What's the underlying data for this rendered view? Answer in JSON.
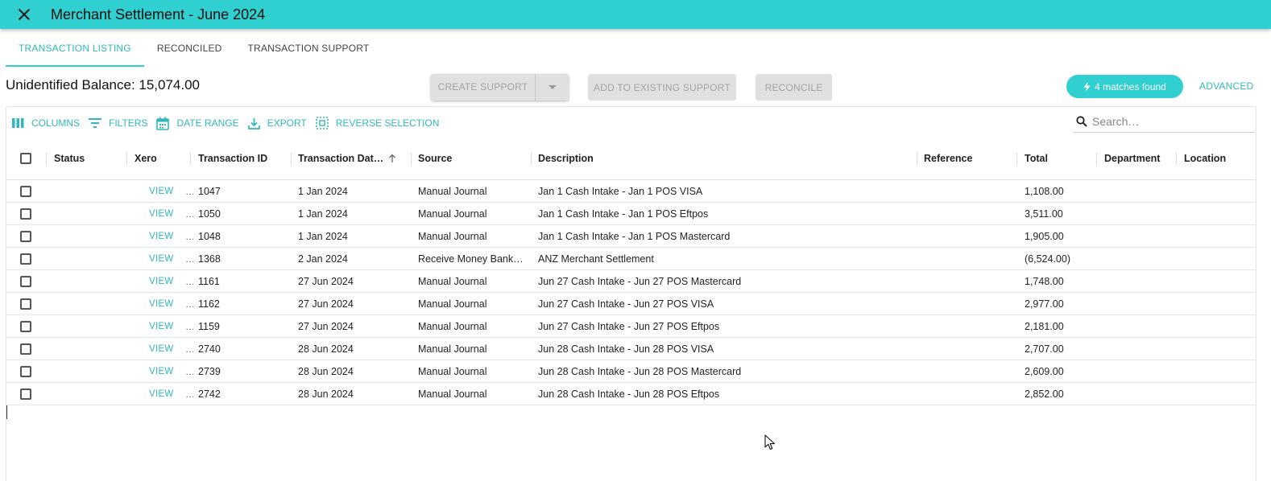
{
  "header": {
    "title": "Merchant Settlement - June 2024"
  },
  "tabs": [
    {
      "label": "TRANSACTION LISTING",
      "active": true
    },
    {
      "label": "RECONCILED",
      "active": false
    },
    {
      "label": "TRANSACTION SUPPORT",
      "active": false
    }
  ],
  "balance": {
    "text": "Unidentified Balance: 15,074.00"
  },
  "actions": {
    "create_support": "CREATE SUPPORT",
    "add_existing": "ADD TO EXISTING SUPPORT",
    "reconcile": "RECONCILE",
    "matches": "4 matches found",
    "advanced": "ADVANCED"
  },
  "toolbar": {
    "columns": "COLUMNS",
    "filters": "FILTERS",
    "date_range": "DATE RANGE",
    "export": "EXPORT",
    "reverse_selection": "REVERSE SELECTION"
  },
  "search": {
    "placeholder": "Search…",
    "value": ""
  },
  "table": {
    "columns": [
      "Status",
      "Xero",
      "Transaction ID",
      "Transaction Dat…",
      "Source",
      "Description",
      "Reference",
      "Total",
      "Department",
      "Location"
    ],
    "sort": {
      "column": "Transaction Dat…",
      "direction": "ascending"
    },
    "view_label": "VIEW",
    "overflow_mark": "…",
    "rows": [
      {
        "id": "1047",
        "date": "1 Jan 2024",
        "source": "Manual Journal",
        "description": "Jan 1 Cash Intake - Jan 1 POS VISA",
        "reference": "",
        "total": "1,108.00",
        "department": "",
        "location": ""
      },
      {
        "id": "1050",
        "date": "1 Jan 2024",
        "source": "Manual Journal",
        "description": "Jan 1 Cash Intake - Jan 1 POS Eftpos",
        "reference": "",
        "total": "3,511.00",
        "department": "",
        "location": ""
      },
      {
        "id": "1048",
        "date": "1 Jan 2024",
        "source": "Manual Journal",
        "description": "Jan 1 Cash Intake - Jan 1 POS Mastercard",
        "reference": "",
        "total": "1,905.00",
        "department": "",
        "location": ""
      },
      {
        "id": "1368",
        "date": "2 Jan 2024",
        "source": "Receive Money Bank…",
        "description": "ANZ Merchant Settlement",
        "reference": "",
        "total": "(6,524.00)",
        "department": "",
        "location": ""
      },
      {
        "id": "1161",
        "date": "27 Jun 2024",
        "source": "Manual Journal",
        "description": "Jun 27 Cash Intake - Jun 27 POS Mastercard",
        "reference": "",
        "total": "1,748.00",
        "department": "",
        "location": ""
      },
      {
        "id": "1162",
        "date": "27 Jun 2024",
        "source": "Manual Journal",
        "description": "Jun 27 Cash Intake - Jun 27 POS VISA",
        "reference": "",
        "total": "2,977.00",
        "department": "",
        "location": ""
      },
      {
        "id": "1159",
        "date": "27 Jun 2024",
        "source": "Manual Journal",
        "description": "Jun 27 Cash Intake - Jun 27 POS Eftpos",
        "reference": "",
        "total": "2,181.00",
        "department": "",
        "location": ""
      },
      {
        "id": "2740",
        "date": "28 Jun 2024",
        "source": "Manual Journal",
        "description": "Jun 28 Cash Intake - Jun 28 POS VISA",
        "reference": "",
        "total": "2,707.00",
        "department": "",
        "location": ""
      },
      {
        "id": "2739",
        "date": "28 Jun 2024",
        "source": "Manual Journal",
        "description": "Jun 28 Cash Intake - Jun 28 POS Mastercard",
        "reference": "",
        "total": "2,609.00",
        "department": "",
        "location": ""
      },
      {
        "id": "2742",
        "date": "28 Jun 2024",
        "source": "Manual Journal",
        "description": "Jun 28 Cash Intake - Jun 28 POS Eftpos",
        "reference": "",
        "total": "2,852.00",
        "department": "",
        "location": ""
      }
    ]
  },
  "colors": {
    "accent": "#30cfd0",
    "accent_text": "#30b8bd",
    "disabled_bg": "#e0e0e0",
    "disabled_text": "#a3a3a3"
  }
}
